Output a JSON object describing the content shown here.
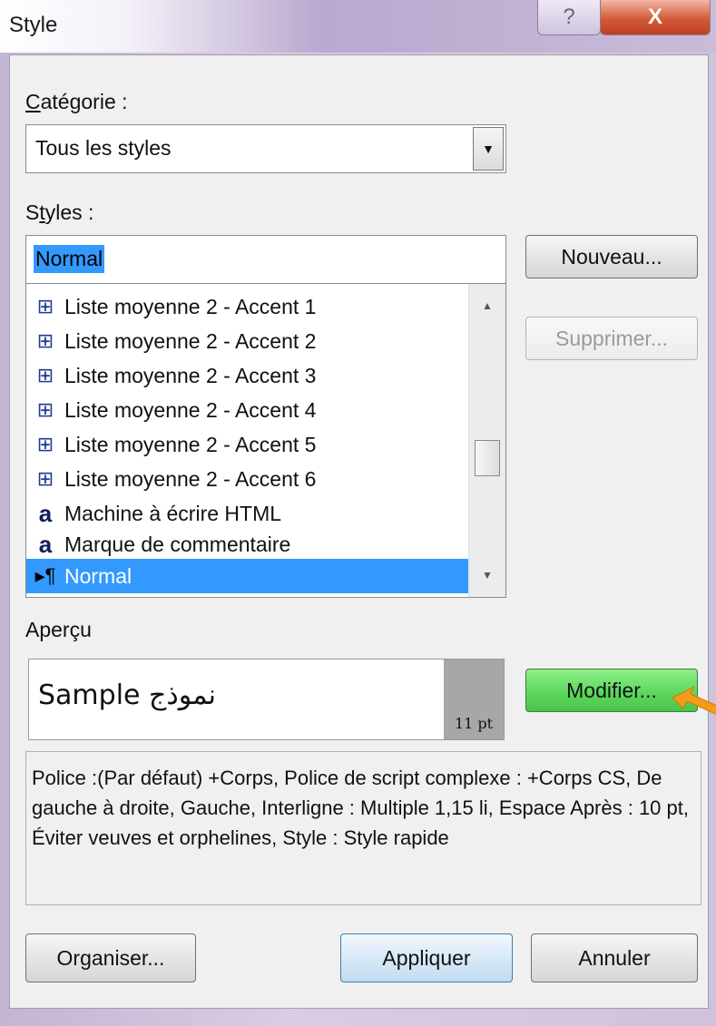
{
  "window": {
    "title": "Style",
    "help_glyph": "?",
    "close_glyph": "X"
  },
  "categorie": {
    "label_first": "C",
    "label_rest": "atégorie :",
    "value": "Tous les styles",
    "dropdown_glyph": "▼"
  },
  "styles": {
    "label_first": "S",
    "label_u": "t",
    "label_rest": "yles :",
    "input_value": "Normal",
    "items": [
      {
        "icon": "⊞",
        "icon_name": "table-style-icon",
        "label": "Liste moyenne 2 - Accent 1"
      },
      {
        "icon": "⊞",
        "icon_name": "table-style-icon",
        "label": "Liste moyenne 2 - Accent 2"
      },
      {
        "icon": "⊞",
        "icon_name": "table-style-icon",
        "label": "Liste moyenne 2 - Accent 3"
      },
      {
        "icon": "⊞",
        "icon_name": "table-style-icon",
        "label": "Liste moyenne 2 - Accent 4"
      },
      {
        "icon": "⊞",
        "icon_name": "table-style-icon",
        "label": "Liste moyenne 2 - Accent 5"
      },
      {
        "icon": "⊞",
        "icon_name": "table-style-icon",
        "label": "Liste moyenne 2 - Accent 6"
      },
      {
        "icon": "a",
        "icon_name": "character-style-icon",
        "label": "Machine à écrire HTML"
      },
      {
        "icon": "a",
        "icon_name": "character-style-icon",
        "label": "Marque de commentaire"
      },
      {
        "icon": "▸¶",
        "icon_name": "paragraph-style-icon",
        "label": "Normal",
        "selected": true
      }
    ],
    "scroll_up": "▲",
    "scroll_down": "▼"
  },
  "buttons": {
    "nouveau": "Nouveau...",
    "supprimer": "Supprimer...",
    "modifier": "Modifier...",
    "organiser": "Organiser...",
    "appliquer": "Appliquer",
    "annuler": "Annuler"
  },
  "apercu": {
    "label": "Aperçu",
    "sample_ar": "نموذج",
    "sample_en": "Sample",
    "size": "11 pt"
  },
  "description": "Police :(Par défaut) +Corps, Police de script complexe : +Corps CS, De gauche à droite, Gauche, Interligne : Multiple 1,15 li, Espace Après : 10 pt, Éviter veuves et orphelines, Style : Style rapide",
  "colors": {
    "selection": "#3399ff",
    "modifier_button": "#5ad65a",
    "pointer_arrow": "#f39c1a"
  }
}
